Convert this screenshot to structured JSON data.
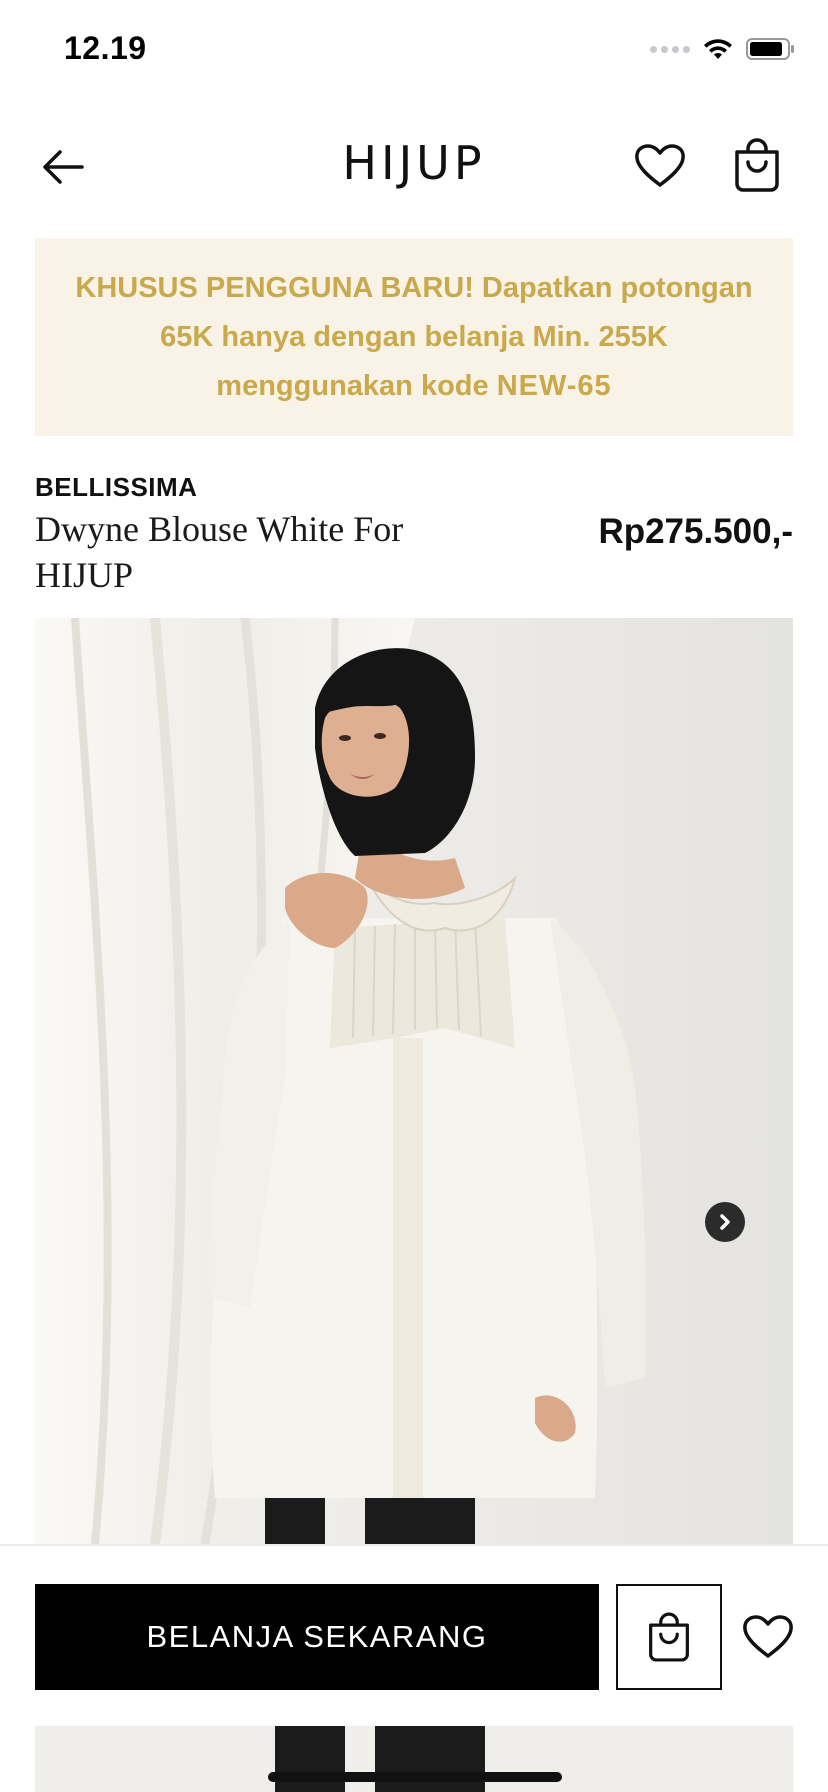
{
  "status_bar": {
    "time": "12.19"
  },
  "header": {
    "logo": "HIJUP"
  },
  "promo": {
    "text": "KHUSUS PENGGUNA BARU! Dapatkan potongan 65K hanya dengan belanja Min. 255K menggunakan kode ",
    "code": "NEW-65",
    "color": "#c9a94c",
    "background": "#f8f3e6"
  },
  "product": {
    "brand": "BELLISSIMA",
    "name": "Dwyne Blouse White For HIJUP",
    "price": "Rp275.500,-"
  },
  "actions": {
    "buy_label": "BELANJA SEKARANG"
  },
  "icons": [
    "back-arrow-icon",
    "heart-icon",
    "shopping-bag-icon",
    "chevron-right-icon",
    "wifi-icon",
    "battery-icon",
    "signal-icon"
  ]
}
